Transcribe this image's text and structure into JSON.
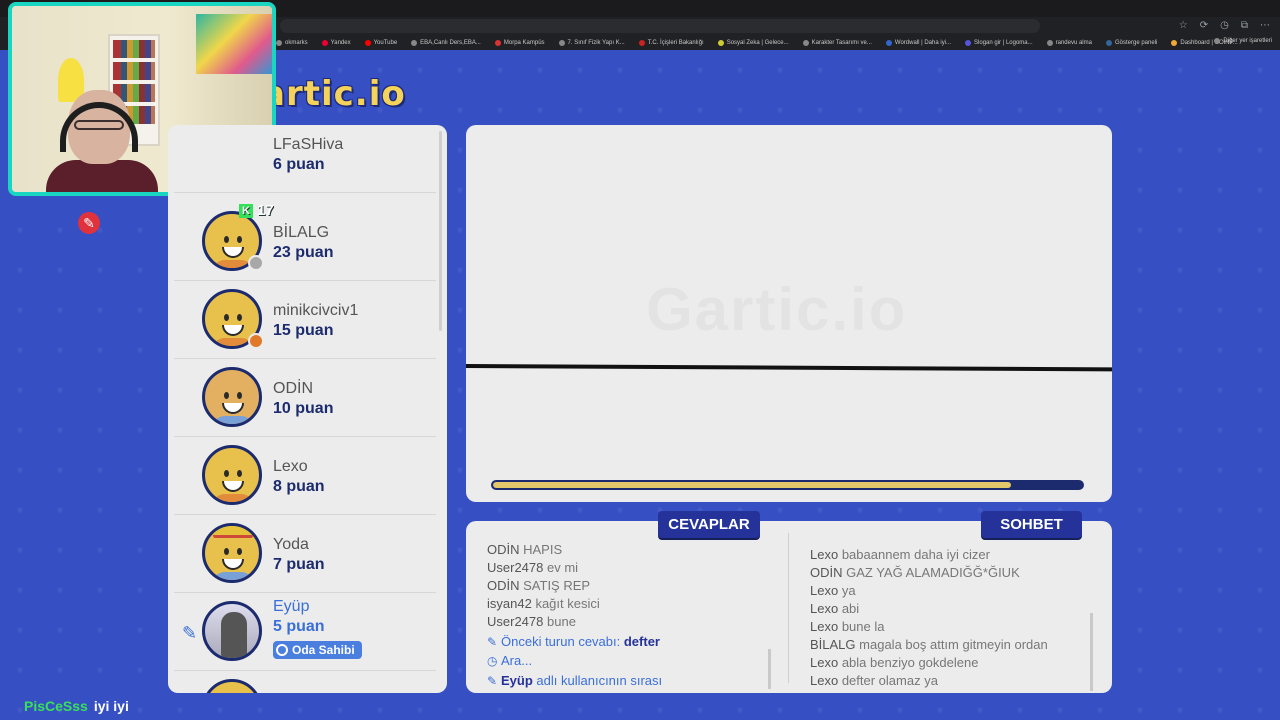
{
  "browser": {
    "bookmarks": [
      "okmarks",
      "Yandex",
      "YouTube",
      "EBA,Canlı Ders,EBA...",
      "Morpa Kampüs",
      "7. Sınıf Fizik Yapı K...",
      "T.C. İçişleri Bakanlığı",
      "Sosyal Zeka | Gelece...",
      "Karakter Tasarımı ve...",
      "Wordwall | Daha iyi...",
      "Slogan gir | Logoma...",
      "randevu alma",
      "Gösterge paneli",
      "Dashboard | COINP..."
    ],
    "other_bookmarks": "Diğer yer işaretleri"
  },
  "logo": "artic.io",
  "combo": {
    "icon": "K",
    "value": "17"
  },
  "players": [
    {
      "name": "LFaSHiva",
      "score": "6 puan",
      "status_color": ""
    },
    {
      "name": "BİLALG",
      "score": "23 puan",
      "status_color": "#a8a8a8"
    },
    {
      "name": "minikcivciv1",
      "score": "15 puan",
      "status_color": "#e07a2a"
    },
    {
      "name": "ODİN",
      "score": "10 puan",
      "status_color": ""
    },
    {
      "name": "Lexo",
      "score": "8 puan",
      "status_color": ""
    },
    {
      "name": "Yoda",
      "score": "7 puan",
      "status_color": ""
    },
    {
      "name": "Eyüp",
      "score": "5 puan",
      "badge": "Oda Sahibi"
    }
  ],
  "canvas": {
    "watermark": "Gartic.io",
    "timer_progress": 0.88
  },
  "tabs": {
    "answers": "CEVAPLAR",
    "chat": "SOHBET"
  },
  "answers": [
    {
      "user": "ODİN",
      "text": "HAPIS"
    },
    {
      "user": "User2478",
      "text": "ev mi"
    },
    {
      "user": "ODİN",
      "text": "SATIŞ REP"
    },
    {
      "user": "isyan42",
      "text": "kağıt kesici"
    },
    {
      "user": "User2478",
      "text": "bune"
    }
  ],
  "system": {
    "prev_answer_label": "Önceki turun cevabı:",
    "prev_answer": "defter",
    "break": "Ara...",
    "turn_user": "Eyüp",
    "turn_text": "adlı kullanıcının sırası"
  },
  "chat": [
    {
      "user": "Lexo",
      "text": "babaannem daha iyi cizer"
    },
    {
      "user": "ODİN",
      "text": "GAZ YAĞ ALAMADIĞĞ*ĞIUK"
    },
    {
      "user": "Lexo",
      "text": "ya"
    },
    {
      "user": "Lexo",
      "text": "abi"
    },
    {
      "user": "Lexo",
      "text": "bune la"
    },
    {
      "user": "BİLALG",
      "text": "magala boş attım gitmeyin ordan"
    },
    {
      "user": "Lexo",
      "text": "abla benziyo gokdelene"
    },
    {
      "user": "Lexo",
      "text": "defter olamaz ya"
    }
  ],
  "stream_chat": {
    "user": "PisCeSss",
    "text": "iyi iyi"
  }
}
